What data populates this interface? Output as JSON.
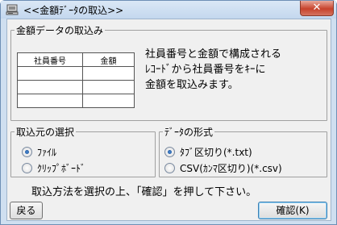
{
  "window": {
    "title": "<<金額ﾃﾞｰﾀの取込>>",
    "close_label": "✕"
  },
  "import_group": {
    "title": "金額データの取込み",
    "columns": [
      "社員番号",
      "金額"
    ],
    "row_count": 3,
    "description": [
      "社員番号と金額で構成される",
      "ﾚｺｰﾄﾞから社員番号をｷｰに",
      "金額を取込みます。"
    ]
  },
  "source_group": {
    "title": "取込元の選択",
    "options": [
      {
        "label": "ﾌｧｲﾙ",
        "selected": true
      },
      {
        "label": "ｸﾘｯﾌﾟﾎﾞｰﾄﾞ",
        "selected": false
      }
    ]
  },
  "format_group": {
    "title": "ﾃﾞｰﾀの形式",
    "options": [
      {
        "label": "ﾀﾌﾞ区切り(*.txt)",
        "selected": true
      },
      {
        "label": "CSV(ｶﾝﾏ区切り)(*.csv)",
        "selected": false
      }
    ]
  },
  "instruction": "取込方法を選択の上、「確認」を押して下さい。",
  "buttons": {
    "back": "戻る",
    "confirm": "確認(K)"
  }
}
